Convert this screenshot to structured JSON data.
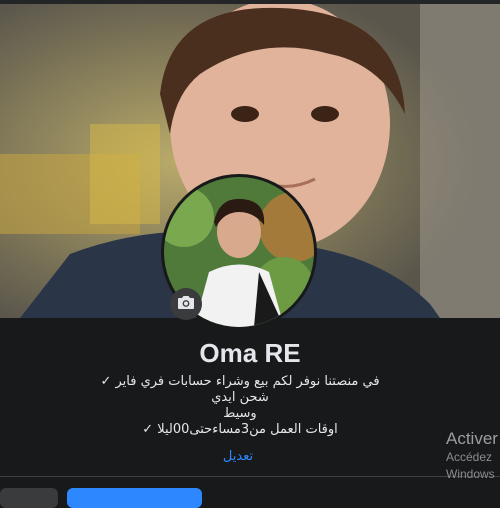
{
  "profile": {
    "name": "Oma RE",
    "bio_lines": [
      "في منصتنا نوفر لكم بيع وشراء حسابات فري فاير ✓",
      "شحن ايدي",
      "وسيط",
      "اوقات العمل من3مساءحتى00ليلا ✓"
    ],
    "edit_label": "تعديل"
  },
  "icons": {
    "camera": "camera-icon"
  },
  "colors": {
    "accent": "#2d88ff",
    "background": "#18191a",
    "secondary_button": "#3a3b3c"
  },
  "watermark": {
    "title": "Activer",
    "line1": "Accédez",
    "line2": "Windows"
  }
}
